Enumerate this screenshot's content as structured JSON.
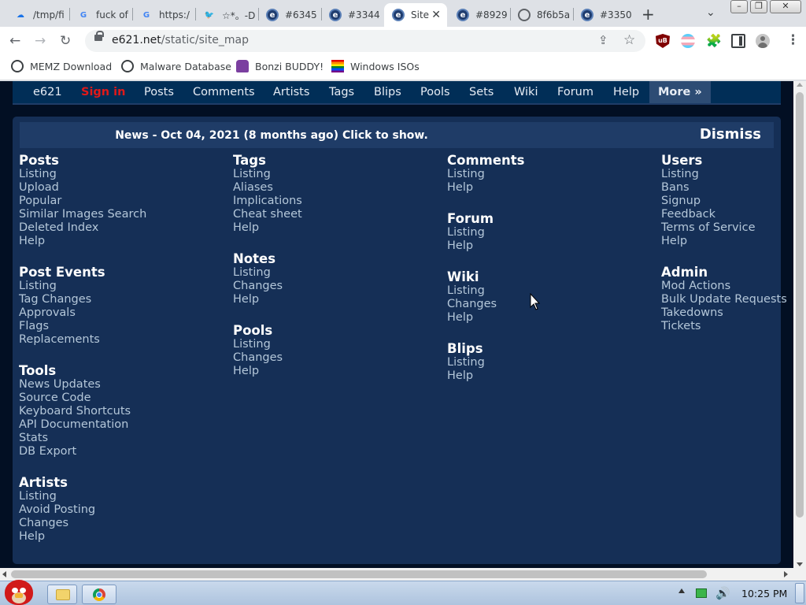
{
  "browser": {
    "tabs": [
      {
        "title": "/tmp/fi",
        "icon": "cloud-icon",
        "active": false
      },
      {
        "title": "fuck of",
        "icon": "google-icon",
        "active": false
      },
      {
        "title": "https:/",
        "icon": "google-icon",
        "active": false
      },
      {
        "title": "☆*。-D",
        "icon": "twitter-icon",
        "active": false
      },
      {
        "title": "#6345",
        "icon": "e621-icon",
        "active": false
      },
      {
        "title": "#3344",
        "icon": "e621-icon",
        "active": false
      },
      {
        "title": "Site",
        "icon": "e621-icon",
        "active": true
      },
      {
        "title": "#8929",
        "icon": "e621-icon",
        "active": false
      },
      {
        "title": "8f6b5a",
        "icon": "globe-icon",
        "active": false
      },
      {
        "title": "#3350",
        "icon": "e621-icon",
        "active": false
      }
    ],
    "new_tab_label": "+",
    "url_host": "e621.net",
    "url_path": "/static/site_map",
    "bookmarks": [
      {
        "label": "MEMZ Download",
        "icon": "globe-icon"
      },
      {
        "label": "Malware Database",
        "icon": "globe-icon"
      },
      {
        "label": "Bonzi BUDDY!",
        "icon": "bonzi-icon"
      },
      {
        "label": "Windows ISOs",
        "icon": "rainbow-flag-icon"
      }
    ]
  },
  "site": {
    "nav": [
      {
        "label": "e621",
        "kind": "brand"
      },
      {
        "label": "Sign in",
        "kind": "signin"
      },
      {
        "label": "Posts"
      },
      {
        "label": "Comments"
      },
      {
        "label": "Artists"
      },
      {
        "label": "Tags"
      },
      {
        "label": "Blips"
      },
      {
        "label": "Pools"
      },
      {
        "label": "Sets"
      },
      {
        "label": "Wiki"
      },
      {
        "label": "Forum"
      },
      {
        "label": "Help"
      }
    ],
    "more_label": "More »",
    "news": {
      "text": "News - Oct 04, 2021 (8 months ago) Click to show.",
      "dismiss": "Dismiss"
    },
    "columns": [
      [
        {
          "title": "Posts",
          "links": [
            "Listing",
            "Upload",
            "Popular",
            "Similar Images Search",
            "Deleted Index",
            "Help"
          ]
        },
        {
          "title": "Post Events",
          "links": [
            "Listing",
            "Tag Changes",
            "Approvals",
            "Flags",
            "Replacements"
          ]
        },
        {
          "title": "Tools",
          "links": [
            "News Updates",
            "Source Code",
            "Keyboard Shortcuts",
            "API Documentation",
            "Stats",
            "DB Export"
          ]
        },
        {
          "title": "Artists",
          "links": [
            "Listing",
            "Avoid Posting",
            "Changes",
            "Help"
          ]
        }
      ],
      [
        {
          "title": "Tags",
          "links": [
            "Listing",
            "Aliases",
            "Implications",
            "Cheat sheet",
            "Help"
          ]
        },
        {
          "title": "Notes",
          "links": [
            "Listing",
            "Changes",
            "Help"
          ]
        },
        {
          "title": "Pools",
          "links": [
            "Listing",
            "Changes",
            "Help"
          ]
        }
      ],
      [
        {
          "title": "Comments",
          "links": [
            "Listing",
            "Help"
          ]
        },
        {
          "title": "Forum",
          "links": [
            "Listing",
            "Help"
          ]
        },
        {
          "title": "Wiki",
          "links": [
            "Listing",
            "Changes",
            "Help"
          ]
        },
        {
          "title": "Blips",
          "links": [
            "Listing",
            "Help"
          ]
        }
      ],
      [
        {
          "title": "Users",
          "links": [
            "Listing",
            "Bans",
            "Signup",
            "Feedback",
            "Terms of Service",
            "Help"
          ]
        },
        {
          "title": "Admin",
          "links": [
            "Mod Actions",
            "Bulk Update Requests",
            "Takedowns",
            "Tickets"
          ]
        }
      ]
    ]
  },
  "taskbar": {
    "clock": "10:25 PM"
  }
}
